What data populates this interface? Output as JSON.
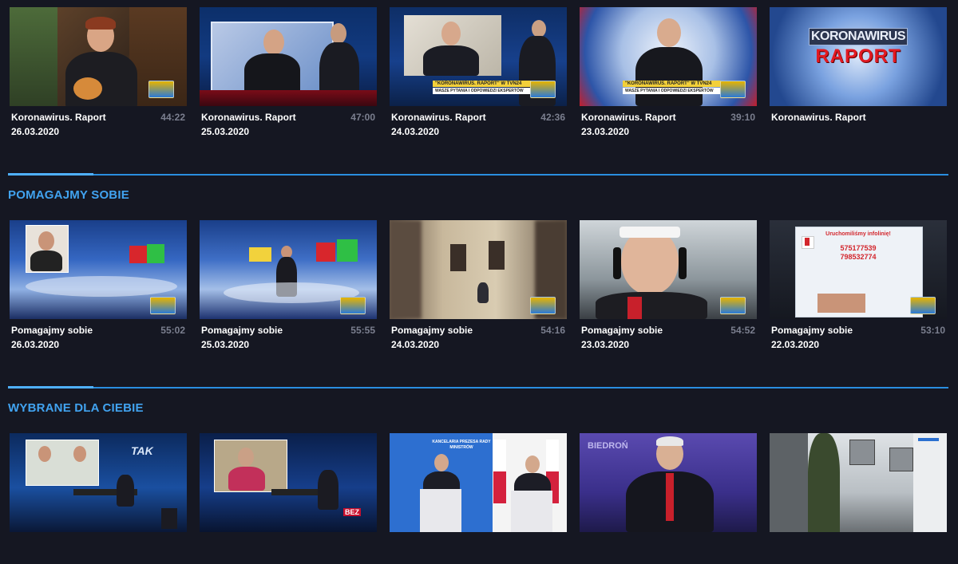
{
  "rows": [
    {
      "cards": [
        {
          "title": "Koronawirus. Raport",
          "date": "26.03.2020",
          "duration": "44:22"
        },
        {
          "title": "Koronawirus. Raport",
          "date": "25.03.2020",
          "duration": "47:00"
        },
        {
          "title": "Koronawirus. Raport",
          "date": "24.03.2020",
          "duration": "42:36",
          "ticker": "\"KORONAWIRUS. RAPORT\" W TVN24",
          "ticker_sub": "WASZE PYTANIA I ODPOWIEDZI EKSPERTÓW"
        },
        {
          "title": "Koronawirus. Raport",
          "date": "23.03.2020",
          "duration": "39:10",
          "ticker": "\"KORONAWIRUS. RAPORT\" W TVN24",
          "ticker_sub": "WASZE PYTANIA I ODPOWIEDZI EKSPERTÓW"
        },
        {
          "title": "Koronawirus. Raport",
          "date": "",
          "duration": "",
          "logo_line1": "KORONAWIRUS",
          "logo_line2": "RAPORT"
        }
      ]
    },
    {
      "section_title": "POMAGAJMY SOBIE",
      "cards": [
        {
          "title": "Pomagajmy sobie",
          "date": "26.03.2020",
          "duration": "55:02"
        },
        {
          "title": "Pomagajmy sobie",
          "date": "25.03.2020",
          "duration": "55:55"
        },
        {
          "title": "Pomagajmy sobie",
          "date": "24.03.2020",
          "duration": "54:16"
        },
        {
          "title": "Pomagajmy sobie",
          "date": "23.03.2020",
          "duration": "54:52"
        },
        {
          "title": "Pomagajmy sobie",
          "date": "22.03.2020",
          "duration": "53:10",
          "screen_heading": "Uruchomiliśmy infolinię!",
          "phone_1": "575177539",
          "phone_2": "798532774"
        }
      ]
    },
    {
      "section_title": "WYBRANE DLA CIEBIE",
      "cards": [
        {
          "overlay_text": "TAK"
        },
        {
          "overlay_text": "BEZ"
        },
        {
          "overlay_text": "KANCELARIA PREZESA RADY MINISTRÓW"
        },
        {
          "overlay_text": "BIEDROŃ"
        },
        {}
      ]
    }
  ],
  "colors": {
    "background": "#151722",
    "accent": "#41a3f0",
    "duration_text": "#7b7f8f"
  }
}
